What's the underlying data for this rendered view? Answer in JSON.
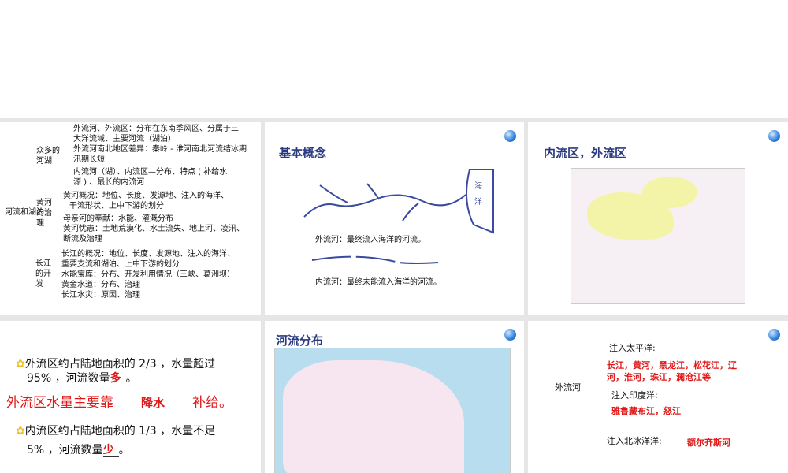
{
  "slide1": {
    "root": "河流和湖泊",
    "groups": [
      {
        "label": "众多的河湖",
        "lines": [
          "外流河、外流区：分布在东南季风区、分属于三",
          "大洋流域、主要河流（湖泊）",
          "外流河南北地区差异：秦岭 - 淮河南北河流结冰期",
          "汛期长短",
          "内流河（湖）、内流区—分布、特点 ( 补给水",
          "源 ) 、最长的内流河"
        ]
      },
      {
        "label": "黄河的治理",
        "lines": [
          "黄河概况：地位、长度、发源地、注入的海洋、",
          "干流形状、上中下游的划分",
          "母亲河的奉献：水能、灌溉分布",
          "黄河忧患：土地荒漠化、水土流失、地上河、凌汛、",
          "断流及治理"
        ]
      },
      {
        "label": "长江的开发",
        "lines": [
          "长江的概况：地位、长度、发源地、注入的海洋、",
          "重要支流和湖泊、上中下游的划分",
          "水能宝库：分布、开发利用情况（三峡、葛洲坝）",
          "黄金水道：分布、治理",
          "长江水灾：原因、治理"
        ]
      }
    ]
  },
  "slide2": {
    "title": "基本概念",
    "ocean": "海洋",
    "outflow": "外流河：最终流入海洋的河流。",
    "inflow": "内流河：最终未能流入海洋的河流。"
  },
  "slide3": {
    "title": "内流区，外流区"
  },
  "slide4": {
    "p1a": "外流区约占陆地面积的 2/3 ，水量超过",
    "p1b": "95% ，河流数量",
    "a1": "多",
    "end": "。",
    "p2a": "外流区水量主要靠",
    "a2": "降水",
    "p2b": "补给。",
    "p3a": "内流区约占陆地面积的 1/3 ，水量不足",
    "p3b": "5% ，河流数量",
    "a3": "少"
  },
  "slide5": {
    "title": "河流分布"
  },
  "slide6": {
    "label": "外流河",
    "pac": "注入太平洋:",
    "pac_rivers1": "长江，黄河，黑龙江，松花江，辽",
    "pac_rivers2": "河，淮河，珠江，澜沧江等",
    "ind": "注入印度洋:",
    "ind_rivers": "雅鲁藏布江，怒江",
    "arc": "注入北冰洋洋:",
    "arc_rivers": "额尔齐斯河"
  }
}
